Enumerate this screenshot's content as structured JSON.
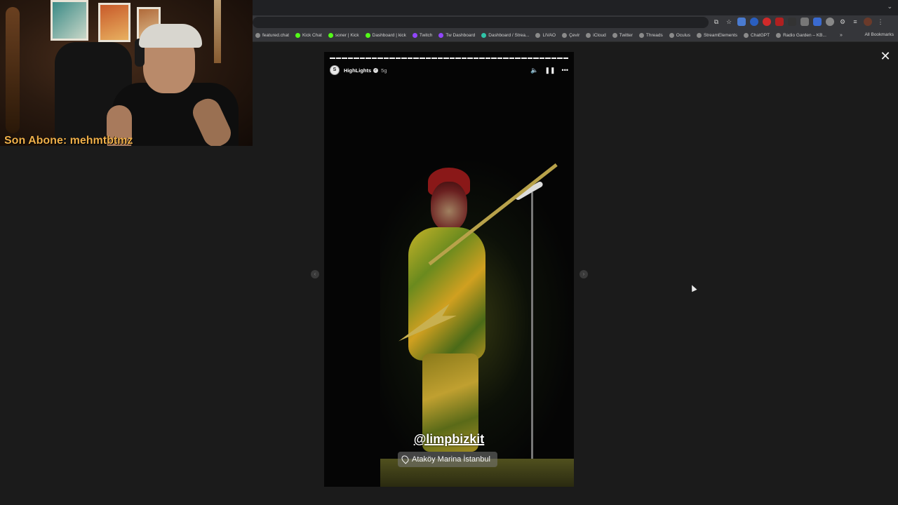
{
  "bookmarks": [
    {
      "label": "featured.chat",
      "color": "#8a8a8a"
    },
    {
      "label": "Kick Chat",
      "color": "#53fc18"
    },
    {
      "label": "soner | Kick",
      "color": "#53fc18"
    },
    {
      "label": "Dashboard | kick",
      "color": "#53fc18"
    },
    {
      "label": "Twitch",
      "color": "#9146ff"
    },
    {
      "label": "Tw Dashboard",
      "color": "#9146ff"
    },
    {
      "label": "Dashboard / Strea...",
      "color": "#2fc4a8"
    },
    {
      "label": "LIVAO",
      "color": "#8a8a8a"
    },
    {
      "label": "Çevir",
      "color": "#8a8a8a"
    },
    {
      "label": "iCloud",
      "color": "#8a8a8a"
    },
    {
      "label": "Twitter",
      "color": "#8a8a8a"
    },
    {
      "label": "Threads",
      "color": "#8a8a8a"
    },
    {
      "label": "Oculus",
      "color": "#8a8a8a"
    },
    {
      "label": "StreamElements",
      "color": "#8a8a8a"
    },
    {
      "label": "ChatGPT",
      "color": "#8a8a8a"
    },
    {
      "label": "Radio Garden – KB...",
      "color": "#8a8a8a"
    }
  ],
  "bookmarks_more": "»",
  "all_bookmarks": "All Bookmarks",
  "webcam": {
    "sub_alert": "Son Abone: mehmtbtmz"
  },
  "story": {
    "username": "HighLights",
    "verified_icon": "verified-badge-icon",
    "time": "5g",
    "mention": "@limpbizkit",
    "location": "Ataköy Marina İstanbul",
    "progress_segments": 40,
    "progress_done": 40
  },
  "icons": {
    "close": "✕",
    "prev": "‹",
    "next": "›",
    "mute": "🔈",
    "pause": "❚❚",
    "more": "•••"
  },
  "colors": {
    "background": "#1b1b1b",
    "sub_alert": "#f0b04a"
  }
}
